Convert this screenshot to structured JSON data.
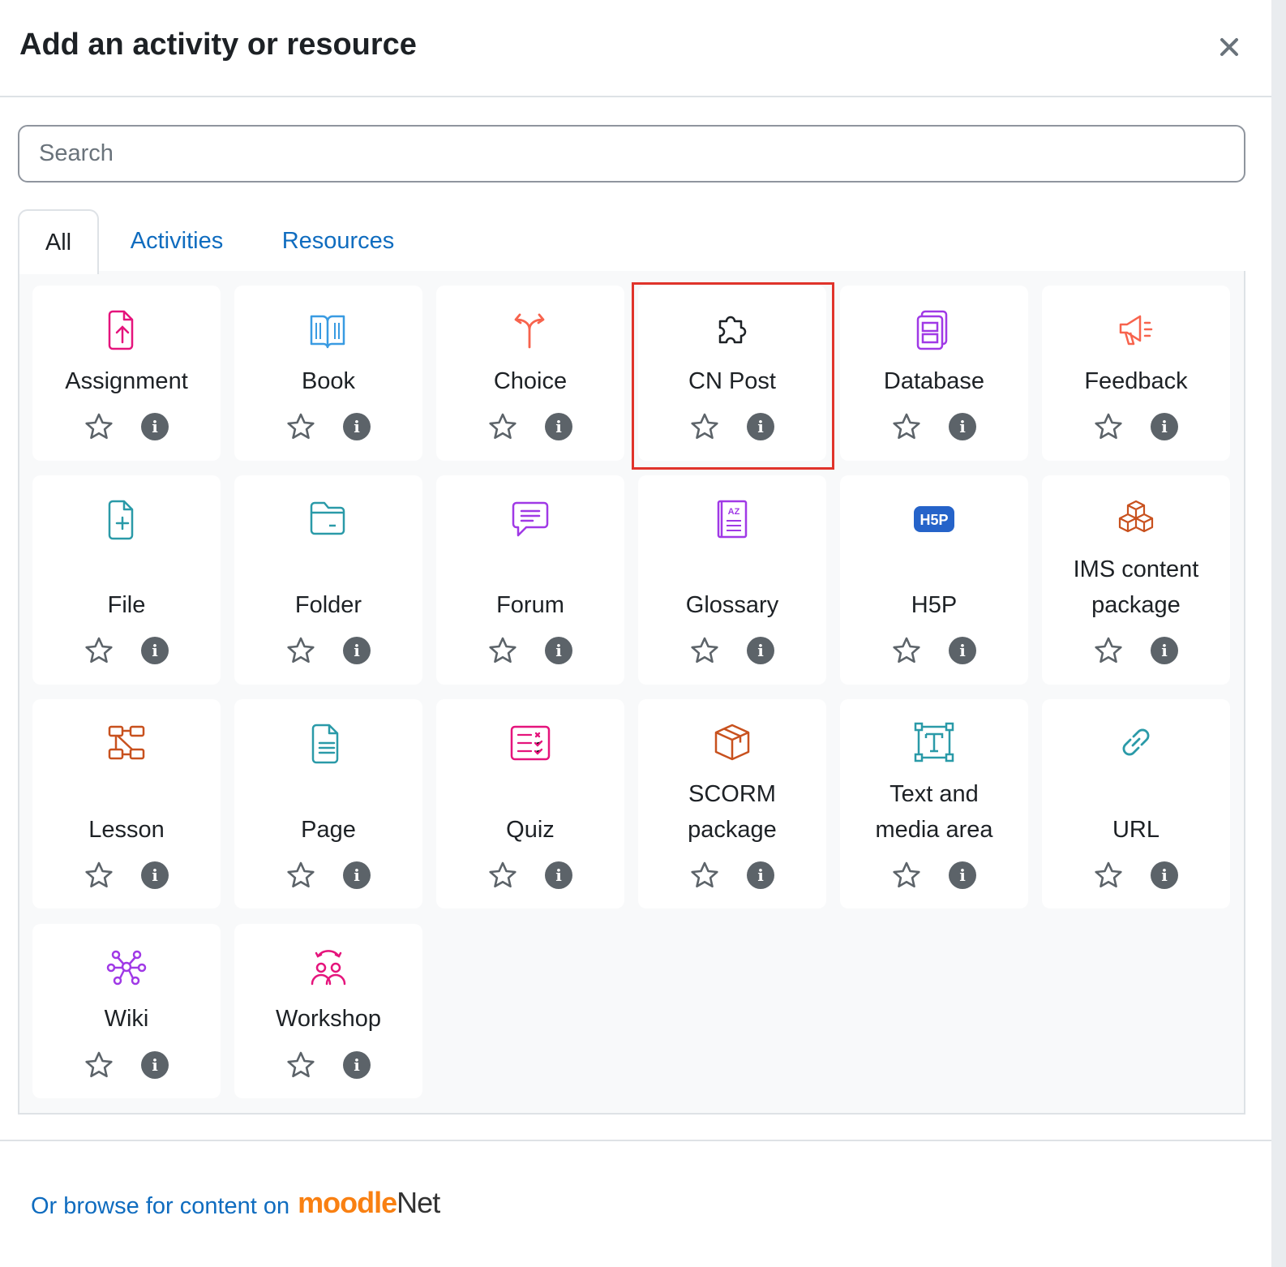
{
  "modal": {
    "title": "Add an activity or resource"
  },
  "search": {
    "placeholder": "Search"
  },
  "tabs": [
    {
      "label": "All"
    },
    {
      "label": "Activities"
    },
    {
      "label": "Resources"
    }
  ],
  "items": [
    {
      "label": "Assignment",
      "icon": "assignment-upload-icon",
      "color": "#e5147c"
    },
    {
      "label": "Book",
      "icon": "book-icon",
      "color": "#399be2"
    },
    {
      "label": "Choice",
      "icon": "choice-arrows-icon",
      "color": "#f7634d"
    },
    {
      "label": "CN Post",
      "icon": "puzzle-piece-icon",
      "color": "#1d2125"
    },
    {
      "label": "Database",
      "icon": "database-icon",
      "color": "#a039e6"
    },
    {
      "label": "Feedback",
      "icon": "megaphone-icon",
      "color": "#f7634d"
    },
    {
      "label": "File",
      "icon": "file-plus-icon",
      "color": "#2a9aa8"
    },
    {
      "label": "Folder",
      "icon": "folder-icon",
      "color": "#2a9aa8"
    },
    {
      "label": "Forum",
      "icon": "forum-bubble-icon",
      "color": "#a039e6"
    },
    {
      "label": "Glossary",
      "icon": "glossary-book-icon",
      "color": "#a039e6"
    },
    {
      "label": "H5P",
      "icon": "h5p-icon",
      "color": "#2563c9"
    },
    {
      "label": "IMS content package",
      "icon": "cubes-icon",
      "color": "#c8511e"
    },
    {
      "label": "Lesson",
      "icon": "lesson-flow-icon",
      "color": "#c8511e"
    },
    {
      "label": "Page",
      "icon": "page-icon",
      "color": "#2a9aa8"
    },
    {
      "label": "Quiz",
      "icon": "quiz-checklist-icon",
      "color": "#e5147c"
    },
    {
      "label": "SCORM package",
      "icon": "box-icon",
      "color": "#c8511e"
    },
    {
      "label": "Text and media area",
      "icon": "text-frame-icon",
      "color": "#2a9aa8"
    },
    {
      "label": "URL",
      "icon": "link-icon",
      "color": "#2a9aa8"
    },
    {
      "label": "Wiki",
      "icon": "wiki-network-icon",
      "color": "#a039e6"
    },
    {
      "label": "Workshop",
      "icon": "workshop-people-icon",
      "color": "#e5147c"
    }
  ],
  "footer": {
    "browse_text": "Or browse for content on",
    "logo_moodle": "moodle",
    "logo_net": "Net"
  }
}
